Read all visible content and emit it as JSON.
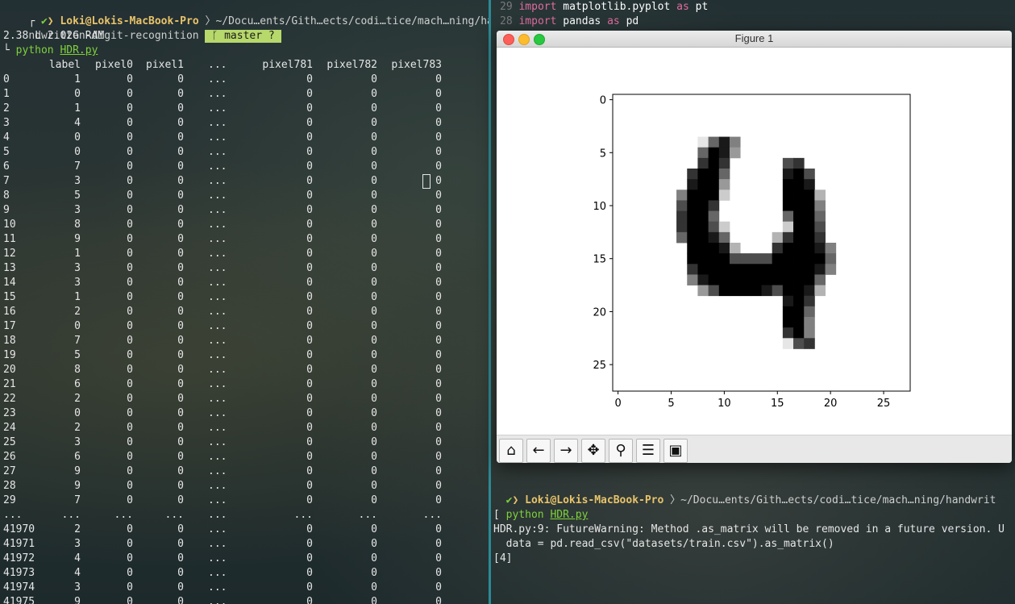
{
  "left_terminal": {
    "prompt_user": "Loki@Lokis-MacBook-Pro",
    "prompt_path": "~/Docu…ents/Gith…ects/codi…tice/mach…ning/ha",
    "prompt_dir_cont": "ndwritten-digit-recognition",
    "branch": "master ?",
    "sysinfo": "2.38 L 2.02G RAM",
    "command_prefix": "python",
    "command_file": "HDR.py",
    "table_header": [
      "label",
      "pixel0",
      "pixel1",
      "...",
      "pixel781",
      "pixel782",
      "pixel783"
    ],
    "rows": [
      [
        "0",
        "1",
        "0",
        "0",
        "...",
        "0",
        "0",
        "0"
      ],
      [
        "1",
        "0",
        "0",
        "0",
        "...",
        "0",
        "0",
        "0"
      ],
      [
        "2",
        "1",
        "0",
        "0",
        "...",
        "0",
        "0",
        "0"
      ],
      [
        "3",
        "4",
        "0",
        "0",
        "...",
        "0",
        "0",
        "0"
      ],
      [
        "4",
        "0",
        "0",
        "0",
        "...",
        "0",
        "0",
        "0"
      ],
      [
        "5",
        "0",
        "0",
        "0",
        "...",
        "0",
        "0",
        "0"
      ],
      [
        "6",
        "7",
        "0",
        "0",
        "...",
        "0",
        "0",
        "0"
      ],
      [
        "7",
        "3",
        "0",
        "0",
        "...",
        "0",
        "0",
        "0"
      ],
      [
        "8",
        "5",
        "0",
        "0",
        "...",
        "0",
        "0",
        "0"
      ],
      [
        "9",
        "3",
        "0",
        "0",
        "...",
        "0",
        "0",
        "0"
      ],
      [
        "10",
        "8",
        "0",
        "0",
        "...",
        "0",
        "0",
        "0"
      ],
      [
        "11",
        "9",
        "0",
        "0",
        "...",
        "0",
        "0",
        "0"
      ],
      [
        "12",
        "1",
        "0",
        "0",
        "...",
        "0",
        "0",
        "0"
      ],
      [
        "13",
        "3",
        "0",
        "0",
        "...",
        "0",
        "0",
        "0"
      ],
      [
        "14",
        "3",
        "0",
        "0",
        "...",
        "0",
        "0",
        "0"
      ],
      [
        "15",
        "1",
        "0",
        "0",
        "...",
        "0",
        "0",
        "0"
      ],
      [
        "16",
        "2",
        "0",
        "0",
        "...",
        "0",
        "0",
        "0"
      ],
      [
        "17",
        "0",
        "0",
        "0",
        "...",
        "0",
        "0",
        "0"
      ],
      [
        "18",
        "7",
        "0",
        "0",
        "...",
        "0",
        "0",
        "0"
      ],
      [
        "19",
        "5",
        "0",
        "0",
        "...",
        "0",
        "0",
        "0"
      ],
      [
        "20",
        "8",
        "0",
        "0",
        "...",
        "0",
        "0",
        "0"
      ],
      [
        "21",
        "6",
        "0",
        "0",
        "...",
        "0",
        "0",
        "0"
      ],
      [
        "22",
        "2",
        "0",
        "0",
        "...",
        "0",
        "0",
        "0"
      ],
      [
        "23",
        "0",
        "0",
        "0",
        "...",
        "0",
        "0",
        "0"
      ],
      [
        "24",
        "2",
        "0",
        "0",
        "...",
        "0",
        "0",
        "0"
      ],
      [
        "25",
        "3",
        "0",
        "0",
        "...",
        "0",
        "0",
        "0"
      ],
      [
        "26",
        "6",
        "0",
        "0",
        "...",
        "0",
        "0",
        "0"
      ],
      [
        "27",
        "9",
        "0",
        "0",
        "...",
        "0",
        "0",
        "0"
      ],
      [
        "28",
        "9",
        "0",
        "0",
        "...",
        "0",
        "0",
        "0"
      ],
      [
        "29",
        "7",
        "0",
        "0",
        "...",
        "0",
        "0",
        "0"
      ],
      [
        "...",
        "...",
        "...",
        "...",
        "...",
        "...",
        "...",
        "..."
      ],
      [
        "41970",
        "2",
        "0",
        "0",
        "...",
        "0",
        "0",
        "0"
      ],
      [
        "41971",
        "3",
        "0",
        "0",
        "...",
        "0",
        "0",
        "0"
      ],
      [
        "41972",
        "4",
        "0",
        "0",
        "...",
        "0",
        "0",
        "0"
      ],
      [
        "41973",
        "4",
        "0",
        "0",
        "...",
        "0",
        "0",
        "0"
      ],
      [
        "41974",
        "3",
        "0",
        "0",
        "...",
        "0",
        "0",
        "0"
      ],
      [
        "41975",
        "9",
        "0",
        "0",
        "...",
        "0",
        "0",
        "0"
      ]
    ]
  },
  "right_terminal": {
    "code_lines": [
      {
        "num": "29",
        "kw1": "import",
        "mod": "matplotlib.pyplot",
        "kw2": "as",
        "alias": "pt"
      },
      {
        "num": "28",
        "kw1": "import",
        "mod": "pandas",
        "kw2": "as",
        "alias": "pd"
      }
    ],
    "prompt_user": "Loki@Lokis-MacBook-Pro",
    "prompt_path": "~/Docu…ents/Gith…ects/codi…tice/mach…ning/handwrit",
    "command_prefix": "python",
    "command_file": "HDR.py",
    "warning_line": "HDR.py:9: FutureWarning: Method .as_matrix will be removed in a future version. U",
    "code_line": "  data = pd.read_csv(\"datasets/train.csv\").as_matrix()",
    "output": "[4]"
  },
  "figure_window": {
    "title": "Figure 1",
    "toolbar_icons": [
      "home-icon",
      "back-arrow-icon",
      "forward-arrow-icon",
      "pan-icon",
      "zoom-icon",
      "configure-icon",
      "save-icon"
    ],
    "toolbar_glyphs": [
      "⌂",
      "←",
      "→",
      "✥",
      "⚲",
      "☰",
      "▣"
    ]
  },
  "chart_data": {
    "type": "heatmap",
    "title": "",
    "xlabel": "",
    "ylabel": "",
    "x_ticks": [
      "0",
      "5",
      "10",
      "15",
      "20",
      "25"
    ],
    "y_ticks": [
      "0",
      "5",
      "10",
      "15",
      "20",
      "25"
    ],
    "xlim": [
      -0.5,
      27.5
    ],
    "ylim": [
      27.5,
      -0.5
    ],
    "colormap": "gray_r",
    "grid_size": [
      28,
      28
    ],
    "pixels": [
      [
        4,
        8,
        0.1
      ],
      [
        4,
        9,
        0.6
      ],
      [
        4,
        10,
        0.9
      ],
      [
        4,
        11,
        0.5
      ],
      [
        5,
        8,
        0.6
      ],
      [
        5,
        9,
        1
      ],
      [
        5,
        10,
        0.9
      ],
      [
        5,
        11,
        0.4
      ],
      [
        6,
        8,
        0.8
      ],
      [
        6,
        9,
        1
      ],
      [
        6,
        10,
        0.8
      ],
      [
        6,
        16,
        0.7
      ],
      [
        6,
        17,
        0.8
      ],
      [
        7,
        7,
        0.8
      ],
      [
        7,
        8,
        1
      ],
      [
        7,
        9,
        1
      ],
      [
        7,
        10,
        0.6
      ],
      [
        7,
        16,
        0.9
      ],
      [
        7,
        17,
        1
      ],
      [
        7,
        18,
        0.7
      ],
      [
        8,
        7,
        0.9
      ],
      [
        8,
        8,
        1
      ],
      [
        8,
        9,
        1
      ],
      [
        8,
        10,
        0.4
      ],
      [
        8,
        16,
        1
      ],
      [
        8,
        17,
        1
      ],
      [
        8,
        18,
        0.9
      ],
      [
        9,
        6,
        0.5
      ],
      [
        9,
        7,
        1
      ],
      [
        9,
        8,
        1
      ],
      [
        9,
        9,
        1
      ],
      [
        9,
        10,
        0.2
      ],
      [
        9,
        16,
        1
      ],
      [
        9,
        17,
        1
      ],
      [
        9,
        18,
        1
      ],
      [
        9,
        19,
        0.3
      ],
      [
        10,
        6,
        0.7
      ],
      [
        10,
        7,
        1
      ],
      [
        10,
        8,
        1
      ],
      [
        10,
        9,
        0.8
      ],
      [
        10,
        16,
        1
      ],
      [
        10,
        17,
        1
      ],
      [
        10,
        18,
        1
      ],
      [
        10,
        19,
        0.5
      ],
      [
        11,
        6,
        0.8
      ],
      [
        11,
        7,
        1
      ],
      [
        11,
        8,
        1
      ],
      [
        11,
        9,
        0.6
      ],
      [
        11,
        16,
        0.6
      ],
      [
        11,
        17,
        1
      ],
      [
        11,
        18,
        1
      ],
      [
        11,
        19,
        0.6
      ],
      [
        12,
        6,
        0.8
      ],
      [
        12,
        7,
        1
      ],
      [
        12,
        8,
        1
      ],
      [
        12,
        9,
        0.7
      ],
      [
        12,
        10,
        0.2
      ],
      [
        12,
        16,
        0.2
      ],
      [
        12,
        17,
        1
      ],
      [
        12,
        18,
        1
      ],
      [
        12,
        19,
        0.7
      ],
      [
        13,
        6,
        0.6
      ],
      [
        13,
        7,
        1
      ],
      [
        13,
        8,
        1
      ],
      [
        13,
        9,
        0.9
      ],
      [
        13,
        10,
        0.6
      ],
      [
        13,
        15,
        0.3
      ],
      [
        13,
        16,
        0.8
      ],
      [
        13,
        17,
        1
      ],
      [
        13,
        18,
        1
      ],
      [
        13,
        19,
        0.8
      ],
      [
        14,
        7,
        1
      ],
      [
        14,
        8,
        1
      ],
      [
        14,
        9,
        1
      ],
      [
        14,
        10,
        0.9
      ],
      [
        14,
        11,
        0.3
      ],
      [
        14,
        15,
        0.8
      ],
      [
        14,
        16,
        1
      ],
      [
        14,
        17,
        1
      ],
      [
        14,
        18,
        1
      ],
      [
        14,
        19,
        0.9
      ],
      [
        14,
        20,
        0.5
      ],
      [
        15,
        7,
        1
      ],
      [
        15,
        8,
        1
      ],
      [
        15,
        9,
        1
      ],
      [
        15,
        10,
        1
      ],
      [
        15,
        11,
        0.7
      ],
      [
        15,
        12,
        0.7
      ],
      [
        15,
        13,
        0.7
      ],
      [
        15,
        14,
        0.7
      ],
      [
        15,
        15,
        1
      ],
      [
        15,
        16,
        1
      ],
      [
        15,
        17,
        1
      ],
      [
        15,
        18,
        1
      ],
      [
        15,
        19,
        1
      ],
      [
        15,
        20,
        0.6
      ],
      [
        16,
        7,
        0.8
      ],
      [
        16,
        8,
        1
      ],
      [
        16,
        9,
        1
      ],
      [
        16,
        10,
        1
      ],
      [
        16,
        11,
        1
      ],
      [
        16,
        12,
        1
      ],
      [
        16,
        13,
        1
      ],
      [
        16,
        14,
        1
      ],
      [
        16,
        15,
        1
      ],
      [
        16,
        16,
        1
      ],
      [
        16,
        17,
        1
      ],
      [
        16,
        18,
        1
      ],
      [
        16,
        19,
        0.9
      ],
      [
        16,
        20,
        0.5
      ],
      [
        17,
        7,
        0.5
      ],
      [
        17,
        8,
        0.9
      ],
      [
        17,
        9,
        1
      ],
      [
        17,
        10,
        1
      ],
      [
        17,
        11,
        1
      ],
      [
        17,
        12,
        1
      ],
      [
        17,
        13,
        1
      ],
      [
        17,
        14,
        1
      ],
      [
        17,
        15,
        1
      ],
      [
        17,
        16,
        1
      ],
      [
        17,
        17,
        1
      ],
      [
        17,
        18,
        1
      ],
      [
        17,
        19,
        0.6
      ],
      [
        18,
        8,
        0.4
      ],
      [
        18,
        9,
        0.7
      ],
      [
        18,
        10,
        1
      ],
      [
        18,
        11,
        1
      ],
      [
        18,
        12,
        1
      ],
      [
        18,
        13,
        1
      ],
      [
        18,
        14,
        0.9
      ],
      [
        18,
        15,
        0.7
      ],
      [
        18,
        16,
        1
      ],
      [
        18,
        17,
        1
      ],
      [
        18,
        18,
        0.9
      ],
      [
        18,
        19,
        0.3
      ],
      [
        19,
        16,
        0.9
      ],
      [
        19,
        17,
        1
      ],
      [
        19,
        18,
        0.8
      ],
      [
        20,
        16,
        1
      ],
      [
        20,
        17,
        1
      ],
      [
        20,
        18,
        0.6
      ],
      [
        21,
        16,
        1
      ],
      [
        21,
        17,
        1
      ],
      [
        21,
        18,
        0.5
      ],
      [
        22,
        16,
        0.8
      ],
      [
        22,
        17,
        1
      ],
      [
        22,
        18,
        0.5
      ],
      [
        23,
        16,
        0.1
      ],
      [
        23,
        17,
        0.7
      ],
      [
        23,
        18,
        0.8
      ]
    ]
  }
}
